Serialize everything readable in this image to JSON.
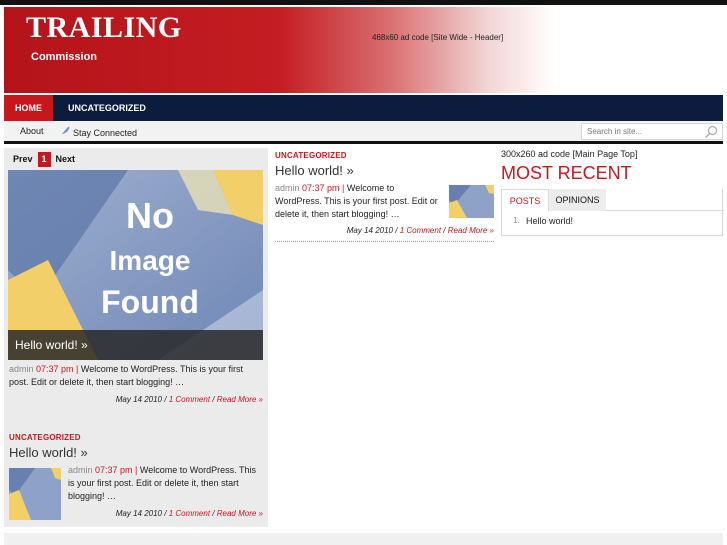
{
  "header": {
    "title": "TRAILING",
    "subtitle": "Commission",
    "ad_text": "468x60 ad code [Site Wide - Header]"
  },
  "nav": {
    "home": "HOME",
    "uncategorized": "UNCATEGORIZED"
  },
  "subnav": {
    "about": "About",
    "stay_connected": "Stay Connected",
    "search_placeholder": "Search in site..."
  },
  "slider": {
    "prev": "Prev",
    "current_page": "1",
    "next": "Next",
    "image_text_line1": "No",
    "image_text_line2": "Image",
    "image_text_line3": "Found",
    "caption": "Hello world! »",
    "author": "admin",
    "time": "07:37 pm |",
    "excerpt": "Welcome to WordPress. This is your first post. Edit or delete it, then start blogging! …",
    "date": "May 14 2010 /",
    "comments": "1 Comment",
    "sep": "/",
    "read_more": "Read More »"
  },
  "left_post": {
    "category": "UNCATEGORIZED",
    "title": "Hello world! »",
    "author": "admin",
    "time": "07:37 pm |",
    "excerpt": "Welcome to WordPress. This is your first post. Edit or delete it, then start blogging! …",
    "date": "May 14 2010 /",
    "comments": "1 Comment",
    "sep": "/",
    "read_more": "Read More »"
  },
  "mid_post": {
    "category": "UNCATEGORIZED",
    "title": "Hello world! »",
    "author": "admin",
    "time": "07:37 pm |",
    "excerpt": "Welcome to WordPress. This is your first post. Edit or delete it, then start blogging! …",
    "date": "May 14 2010 /",
    "comments": "1 Comment",
    "sep": "/",
    "read_more": "Read More »"
  },
  "sidebar": {
    "ad_text": "300x260 ad code [Main Page Top]",
    "heading": "MOST RECENT",
    "tabs": [
      {
        "label": "POSTS",
        "active": true
      },
      {
        "label": "OPINIONS",
        "active": false
      }
    ],
    "list_number": "1.",
    "list_item": "Hello world!"
  },
  "colors": {
    "brand_red": "#c8161d",
    "nav_blue": "#0b1c3f"
  },
  "icons": [
    "search-icon",
    "feather-icon"
  ]
}
